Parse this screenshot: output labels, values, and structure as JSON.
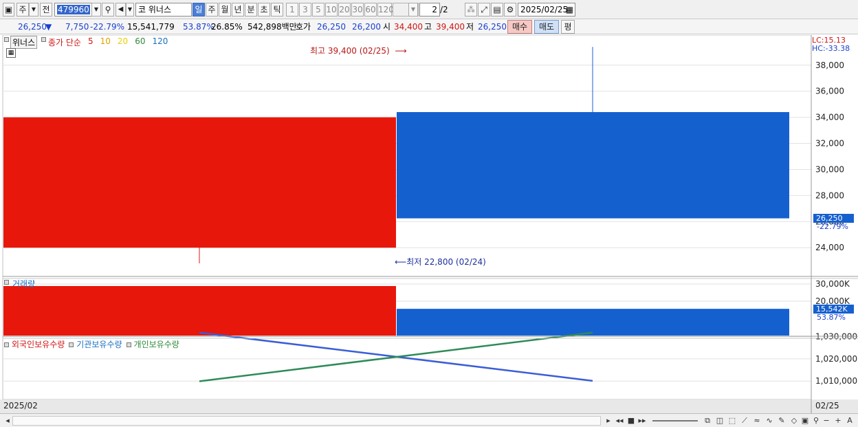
{
  "toolbar": {
    "period_unit": "주",
    "prev_label": "전",
    "code": "479960",
    "market_prefix": "코",
    "stock_name": "위너스",
    "period_tabs": [
      {
        "label": "일",
        "selected": true
      },
      {
        "label": "주",
        "selected": false
      },
      {
        "label": "월",
        "selected": false
      },
      {
        "label": "년",
        "selected": false
      },
      {
        "label": "분",
        "selected": false
      },
      {
        "label": "초",
        "selected": false
      },
      {
        "label": "틱",
        "selected": false
      }
    ],
    "intervals": [
      "1",
      "3",
      "5",
      "10",
      "20",
      "30",
      "60",
      "120"
    ],
    "count_value": "2",
    "count_total": "/2",
    "date": "2025/02/25"
  },
  "quote": {
    "price": "26,250",
    "direction": "▼",
    "change": "7,750",
    "change_pct": "-22.79%",
    "volume": "15,541,779",
    "vol_ratio": "53.87%",
    "turnover_pct": "26.85%",
    "amount": "542,898백만",
    "hoga_label": "호가",
    "ask": "26,250",
    "bid": "26,200",
    "open_label": "시",
    "open": "34,400",
    "high_label": "고",
    "high": "39,400",
    "low_label": "저",
    "low": "26,250",
    "buy_label": "매수",
    "sell_label": "매도",
    "eval_label": "평"
  },
  "price_panel": {
    "legend_name": "위너스",
    "legend_ma_label": "종가 단순",
    "ma_periods": [
      {
        "label": "5",
        "color": "#d01515"
      },
      {
        "label": "10",
        "color": "#e0a000"
      },
      {
        "label": "20",
        "color": "#e8d000"
      },
      {
        "label": "60",
        "color": "#2e8b3a"
      },
      {
        "label": "120",
        "color": "#1a6fc0"
      }
    ],
    "high_note": "최고 39,400 (02/25)",
    "low_note": "최저 22,800 (02/24)",
    "lc": "LC:15.13",
    "hc": "HC:-33.38",
    "last_price": "26,250",
    "last_pct": "-22.79%"
  },
  "volume_panel": {
    "legend": "거래량",
    "last_volume": "15,542K",
    "last_pct": "53.87%"
  },
  "holdings_panel": {
    "legend": [
      "외국인보유수량",
      "기관보유수량",
      "개인보유수량"
    ],
    "legend_colors": [
      "#d01515",
      "#1a6fc0",
      "#2e8b3a"
    ]
  },
  "x_axis": {
    "left_label": "2025/02",
    "right_label": "02/25"
  },
  "chart_data": [
    {
      "type": "candlestick",
      "categories": [
        "02/24",
        "02/25"
      ],
      "series": [
        {
          "open": [
            24000,
            34400
          ],
          "high": [
            34000,
            39400
          ],
          "low": [
            22800,
            26250
          ],
          "close": [
            34000,
            26250
          ]
        }
      ],
      "y_ticks": [
        "24,000",
        "26,000",
        "28,000",
        "30,000",
        "32,000",
        "34,000",
        "36,000",
        "38,000"
      ],
      "ylim": [
        22500,
        39500
      ],
      "colors": {
        "up": "#e8170b",
        "down": "#1560cf"
      }
    },
    {
      "type": "bar",
      "title": "거래량",
      "categories": [
        "02/24",
        "02/25"
      ],
      "values": [
        28800,
        15542
      ],
      "colors": [
        "#e8170b",
        "#1560cf"
      ],
      "y_ticks": [
        "20,000K",
        "30,000K"
      ],
      "ylim": [
        0,
        31000
      ]
    },
    {
      "type": "line",
      "categories": [
        "02/24",
        "02/25"
      ],
      "series": [
        {
          "name": "기관보유수량",
          "color": "#3a5ed6",
          "values": [
            1031800,
            1010100
          ]
        },
        {
          "name": "개인보유수량",
          "color": "#2e8b57",
          "values": [
            1009900,
            1031800
          ]
        }
      ],
      "y_ticks": [
        "1,010,000",
        "1,020,000",
        "1,030,000"
      ],
      "ylim": [
        1009000,
        1033000
      ]
    }
  ]
}
